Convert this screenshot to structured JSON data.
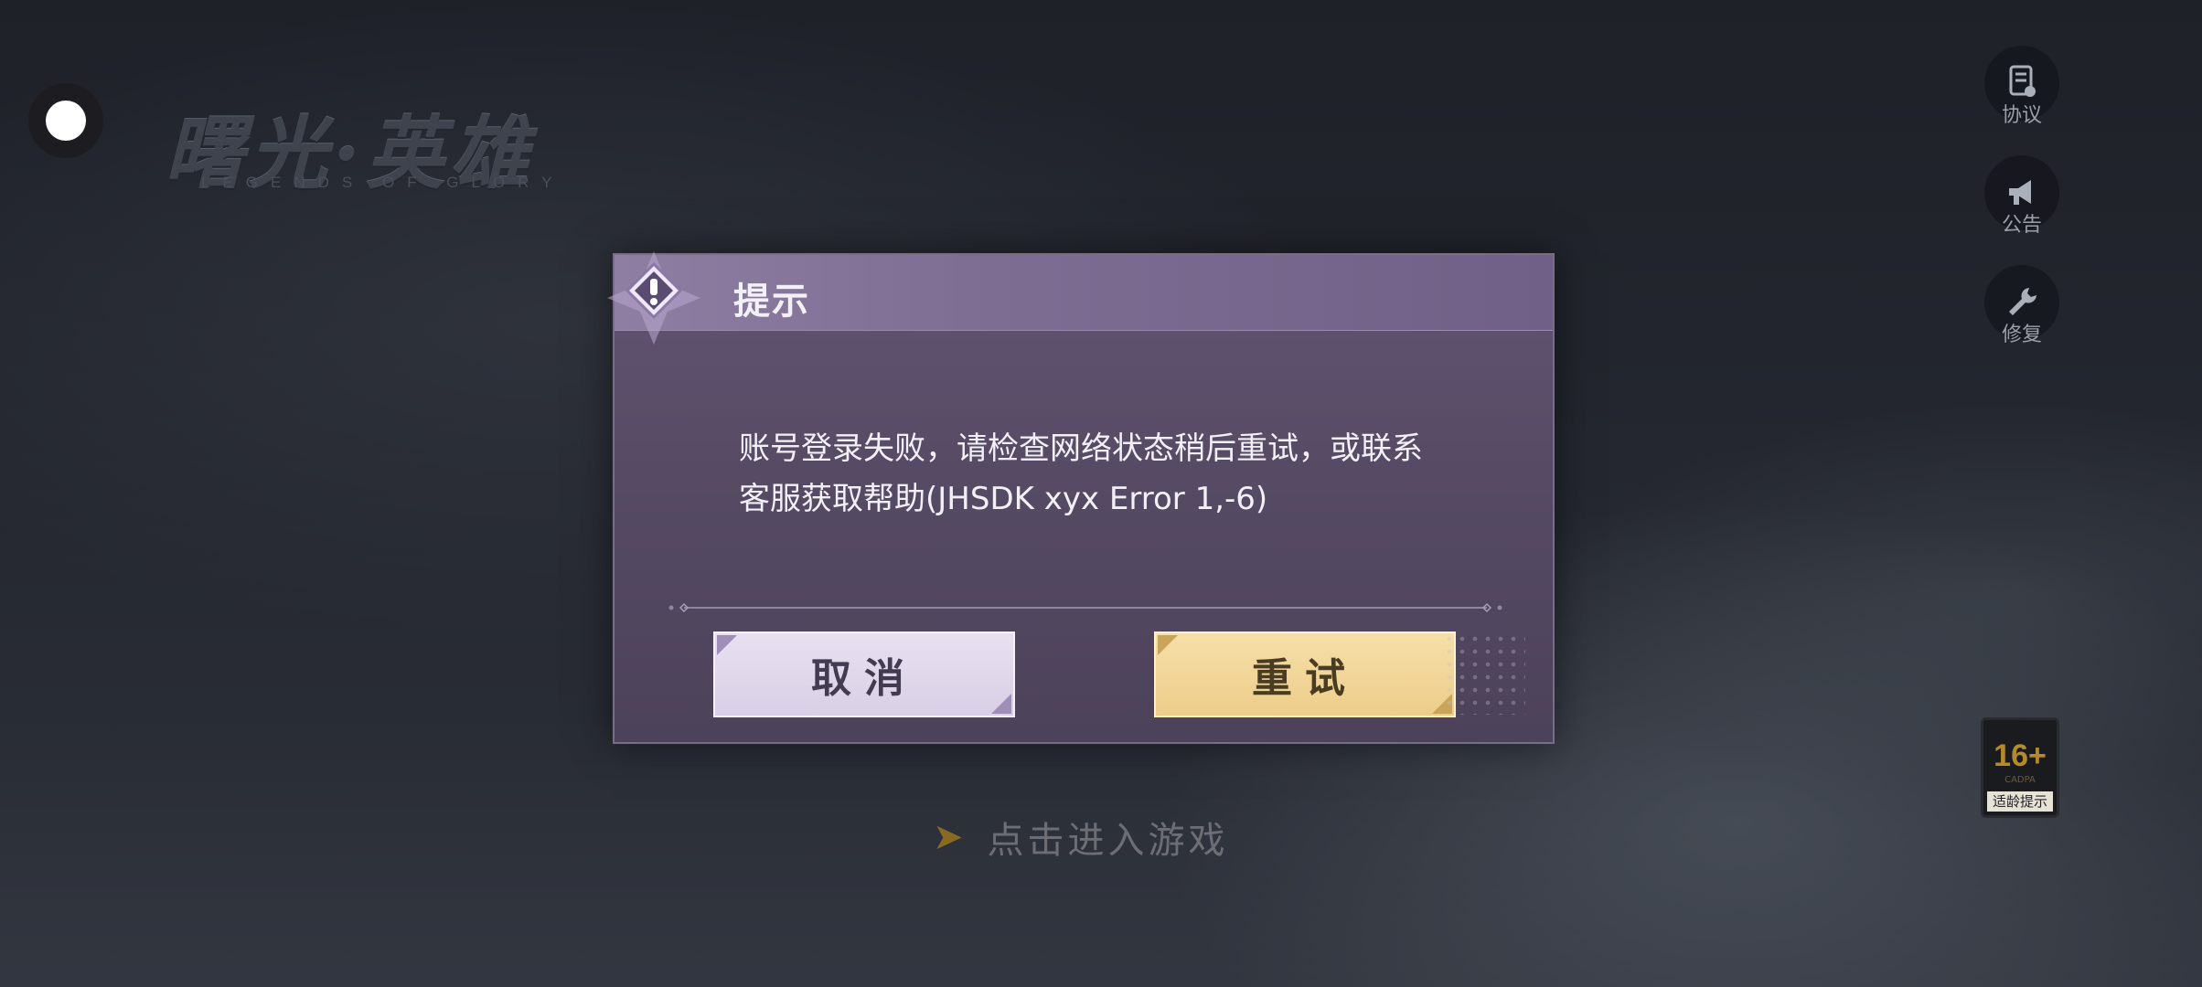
{
  "logo": {
    "title": "曙光·英雄",
    "subtitle": "LEGENDS OF GLORY"
  },
  "side_buttons": [
    {
      "label": "协议",
      "icon": "agreement-icon"
    },
    {
      "label": "公告",
      "icon": "megaphone-icon"
    },
    {
      "label": "修复",
      "icon": "wrench-icon"
    }
  ],
  "age_rating": {
    "value": "16+",
    "org": "CADPA",
    "label": "适龄提示"
  },
  "enter_game": {
    "label": "点击进入游戏"
  },
  "dialog": {
    "title": "提示",
    "message_line1": "账号登录失败，请检查网络状态稍后重试，或联系",
    "message_line2": "客服获取帮助(JHSDK xyx Error 1,-6)",
    "cancel_label": "取消",
    "retry_label": "重试"
  },
  "colors": {
    "dialog_bg": "#574b66",
    "cancel_button": "#d9cfe6",
    "retry_button": "#edcd8a",
    "accent_gold": "#b48a2a"
  }
}
